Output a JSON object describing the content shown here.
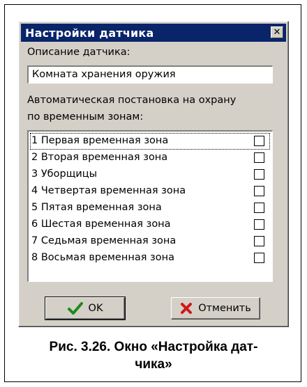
{
  "dialog": {
    "title": "Настройки датчика",
    "close_symbol": "✕",
    "description_label": "Описание датчика:",
    "description_value": "Комната хранения оружия",
    "autoarm_label_line1": "Автоматическая постановка на охрану",
    "autoarm_label_line2": "по временным зонам:",
    "zones": [
      {
        "label": "1 Первая временная зона",
        "checked": false
      },
      {
        "label": "2 Вторая временная зона",
        "checked": false
      },
      {
        "label": "3 Уборщицы",
        "checked": false
      },
      {
        "label": "4 Четвертая временная зона",
        "checked": false
      },
      {
        "label": "5 Пятая временная зона",
        "checked": false
      },
      {
        "label": "6 Шестая временная зона",
        "checked": false
      },
      {
        "label": "7 Седьмая временная зона",
        "checked": false
      },
      {
        "label": "8 Восьмая временная зона",
        "checked": false
      }
    ],
    "ok_label": "OK",
    "cancel_label": "Отменить",
    "ok_icon": "checkmark-icon",
    "cancel_icon": "red-x-icon"
  },
  "caption": {
    "line1": "Рис. 3.26. Окно «Настройка дат-",
    "line2": "чика»"
  },
  "colors": {
    "titlebar": "#0a246a",
    "dialog_face": "#d4d0c8",
    "check_green": "#1a8a1a",
    "cancel_red": "#d01818"
  }
}
